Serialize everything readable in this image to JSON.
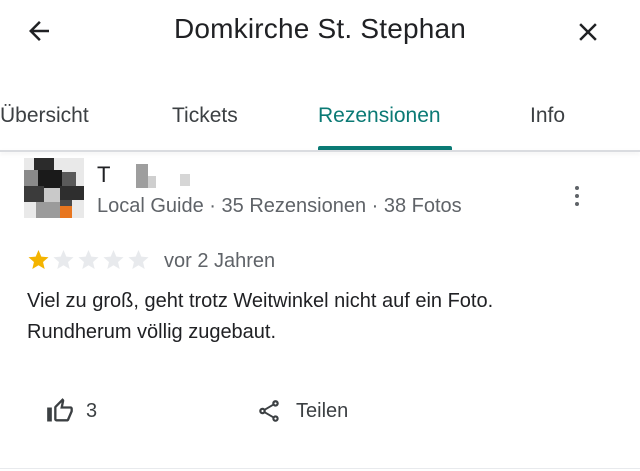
{
  "header": {
    "title": "Domkirche St. Stephan",
    "back_icon": "arrow-left-icon",
    "close_icon": "close-icon"
  },
  "tabs": [
    {
      "label": "Übersicht",
      "active": false
    },
    {
      "label": "Tickets",
      "active": false
    },
    {
      "label": "Rezensionen",
      "active": true
    },
    {
      "label": "Info",
      "active": false
    }
  ],
  "colors": {
    "accent": "#0b7a75",
    "star_filled": "#f4b400",
    "star_empty": "#e8eaed",
    "secondary_text": "#5f6368"
  },
  "review": {
    "reviewer_initial": "T",
    "reviewer_meta": "Local Guide · 35 Rezensionen · 38 Fotos",
    "rating": 1,
    "max_rating": 5,
    "date": "vor 2 Jahren",
    "text": "Viel zu groß,  geht trotz Weitwinkel nicht auf ein Foto.\nRundherum völlig zugebaut.",
    "more_icon": "more-vert-icon"
  },
  "actions": {
    "like_icon": "thumb-up-icon",
    "like_count": "3",
    "share_icon": "share-icon",
    "share_label": "Teilen"
  }
}
